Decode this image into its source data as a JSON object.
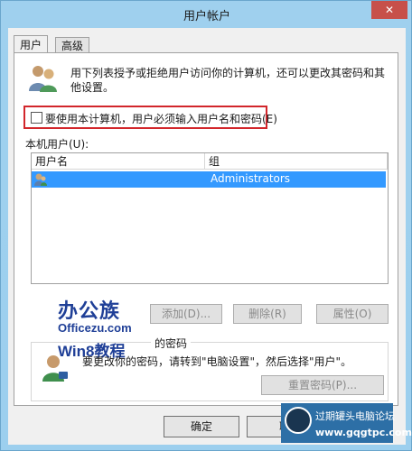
{
  "window": {
    "title": "用户帐户",
    "close": "✕"
  },
  "tabs": [
    {
      "label": "用户"
    },
    {
      "label": "高级"
    }
  ],
  "intro": {
    "text": "用下列表授予或拒绝用户访问你的计算机，还可以更改其密码和其他设置。"
  },
  "require_password": {
    "label": "要使用本计算机，用户必须输入用户名和密码(E)",
    "checked": false
  },
  "users_list": {
    "label": "本机用户(U):",
    "columns": [
      "用户名",
      "组"
    ],
    "rows": [
      {
        "username": "",
        "group": "Administrators",
        "selected": true
      }
    ]
  },
  "list_buttons": {
    "add": "添加(D)...",
    "remove": "删除(R)",
    "properties": "属性(O)"
  },
  "logo": {
    "line1": "办公族",
    "line2": "Officezu.com",
    "line3": "Win8教程"
  },
  "password_group": {
    "title": "的密码",
    "desc": "要更改你的密码，请转到\"电脑设置\"，然后选择\"用户\"。",
    "reset_button": "重置密码(P)..."
  },
  "footer": {
    "ok": "确定",
    "cancel": "取"
  },
  "watermark": {
    "line1": "过期罐头电脑论坛",
    "line2": "www.gqgtpc.com"
  },
  "colors": {
    "selection": "#3399ff",
    "highlight_border": "#d2262b",
    "title_bg": "#9fd0ee"
  },
  "icons": {
    "users": "users-icon",
    "user_row": "user-icon",
    "person": "person-icon"
  }
}
